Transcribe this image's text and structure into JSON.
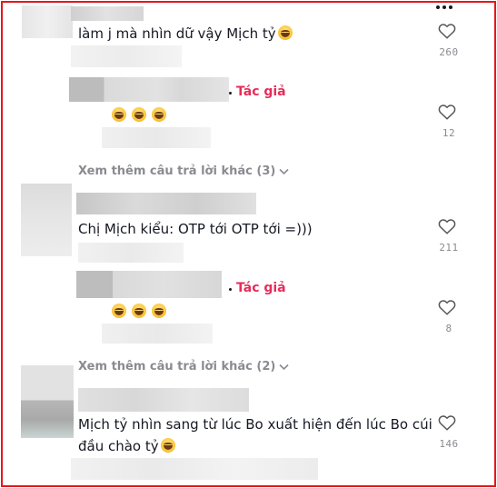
{
  "comments": [
    {
      "text": "làm j mà nhìn dữ vậy Mịch tỷ",
      "likes": "260"
    },
    {
      "author_badge": "Tác giả",
      "likes": "12"
    },
    {
      "text": "Chị Mịch kiểu: OTP tới OTP tới =)))",
      "likes": "211"
    },
    {
      "author_badge": "Tác giả",
      "likes": "8"
    },
    {
      "text_line1": "Mịch tỷ nhìn sang từ lúc Bo xuất hiện đến lúc Bo cúi",
      "text_line2": "đầu chào tỷ",
      "likes": "146"
    }
  ],
  "view_more": [
    {
      "label": "Xem thêm câu trả lời khác (3)"
    },
    {
      "label": "Xem thêm câu trả lời khác (2)"
    }
  ],
  "icons": {
    "like": "heart-icon",
    "expand": "chevron-down-icon",
    "menu": "more-icon",
    "emoji": "laughing-emoji-icon"
  },
  "colors": {
    "frame": "#e4171b",
    "author_badge": "#e52d5a",
    "muted": "#8a8b91"
  }
}
